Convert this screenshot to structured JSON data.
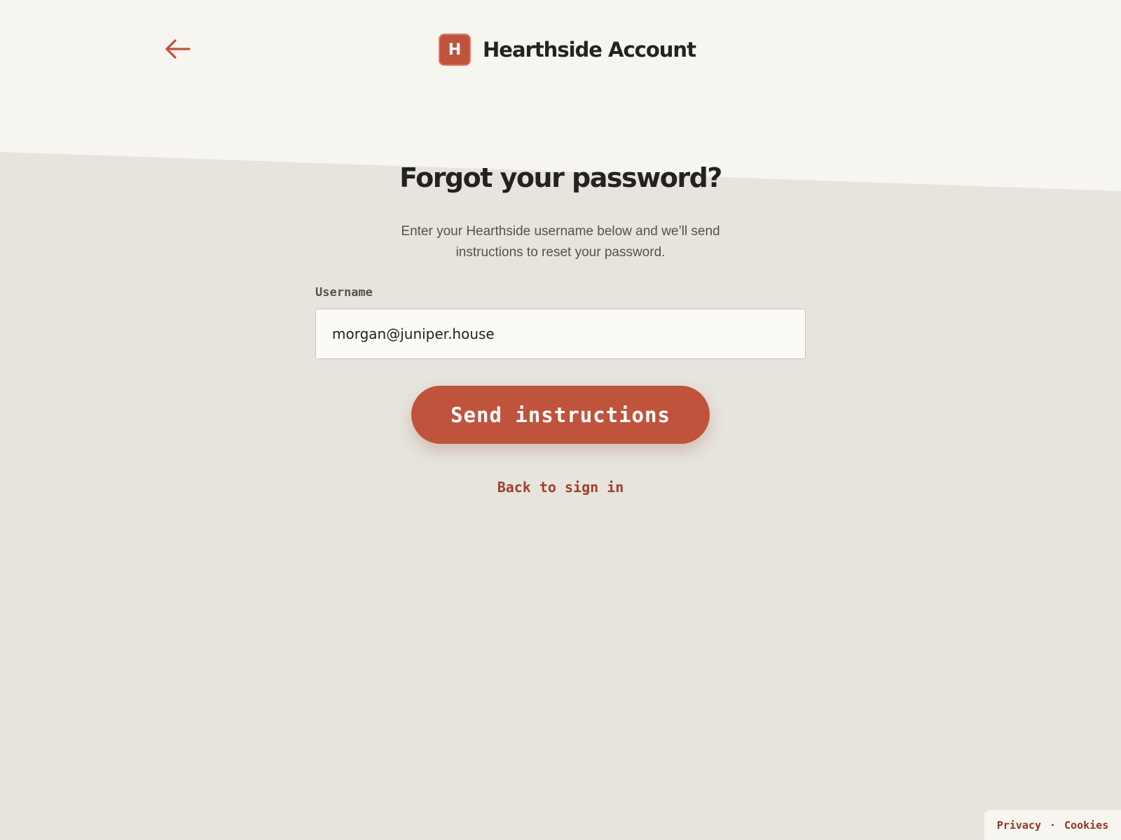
{
  "header": {
    "back_icon": "arrow-left-icon",
    "brand_initial": "H",
    "brand_name": "Hearthside Account"
  },
  "main": {
    "title": "Forgot your password?",
    "subtitle": "Enter your Hearthside username below and we’ll send instructions to reset your password.",
    "field_label": "Username",
    "field_value": "morgan@juniper.house",
    "submit_label": "Send instructions",
    "back_link": "Back to sign in"
  },
  "footer": {
    "privacy": "Privacy",
    "separator": "·",
    "cookies": "Cookies"
  },
  "colors": {
    "accent": "#c0533c",
    "link": "#a0402b",
    "background_top": "#f7f5f0",
    "background_bottom": "#e6e4dd",
    "text_dark": "#232220"
  }
}
